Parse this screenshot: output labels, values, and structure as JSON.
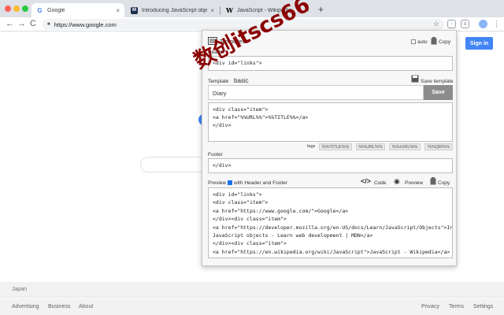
{
  "browser": {
    "tabs": [
      {
        "title": "Google",
        "favicon": "G"
      },
      {
        "title": "Introducing JavaScript objects",
        "favicon": "M"
      },
      {
        "title": "JavaScript - Wikipedia",
        "favicon": "W"
      }
    ],
    "tab_close": "×",
    "new_tab": "+",
    "url": "https://www.google.com",
    "nav": {
      "back": "←",
      "forward": "→",
      "reload": "C"
    },
    "star": "☆"
  },
  "page": {
    "sign_in": "Sign in",
    "country": "Japan",
    "footer_left": [
      "Advertising",
      "Business",
      "About"
    ],
    "footer_right": [
      "Privacy",
      "Terms",
      "Settings"
    ]
  },
  "popup": {
    "title": "Templates",
    "auto_label": "auto",
    "copy_label": "Copy",
    "header_label": "Header",
    "header_value": "<div id=\"links\">",
    "template_label": "Template",
    "template_selected": "basic",
    "save_template_label": "Save template",
    "template_name": "Diary",
    "save_label": "Save",
    "template_body": "<div class=\"item\">\n<a href=\"%%URL%%\">%%TITLE%%</a>\n</div>",
    "tags_label": "tags",
    "tags": [
      "%%TITLE%%",
      "%%URL%%",
      "%%rURL%%",
      "%%QR%%"
    ],
    "footer_label": "Footer",
    "footer_value": "</div>",
    "preview_label": "Preview",
    "with_header_footer": "with Header and Footer",
    "code_label": "Code",
    "preview_btn": "Preview",
    "copy_btn": "Copy",
    "preview_text": "<div id=\"links\">\n<div class=\"item\">\n<a href=\"https://www.google.com/\">Google</a>\n</div><div class=\"item\">\n<a href=\"https://developer.mozilla.org/en-US/docs/Learn/JavaScript/Objects\">Introducing\nJavaScript objects - Learn web development | MDN</a>\n</div><div class=\"item\">\n<a href=\"https://en.wikipedia.org/wiki/JavaScript\">JavaScript - Wikipedia</a>\n</div></div>"
  },
  "watermark": "数创itscs66",
  "colors": {
    "accent": "#4285f4",
    "watermark": "#8b0000",
    "save_button": "#8c8c8c"
  }
}
